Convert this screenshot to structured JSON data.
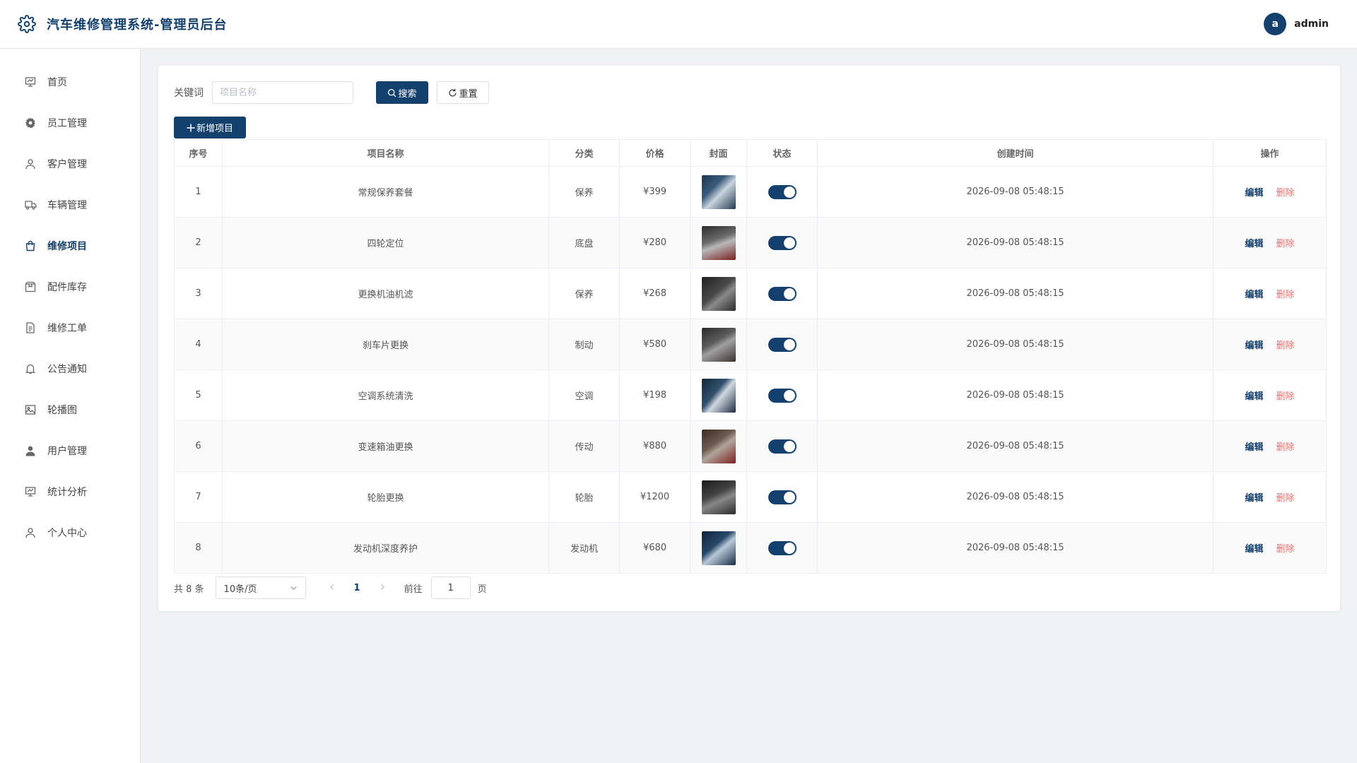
{
  "app": {
    "title": "汽车维修管理系统-管理员后台"
  },
  "user": {
    "avatar_letter": "a",
    "name": "admin"
  },
  "colors": {
    "primary": "#14406e",
    "danger": "#f56c6c",
    "background": "#f0f2f5"
  },
  "sidebar": {
    "items": [
      {
        "label": "首页",
        "icon": "dashboard-icon",
        "active": false
      },
      {
        "label": "员工管理",
        "icon": "gear-icon",
        "active": false
      },
      {
        "label": "客户管理",
        "icon": "user-icon",
        "active": false
      },
      {
        "label": "车辆管理",
        "icon": "truck-icon",
        "active": false
      },
      {
        "label": "维修项目",
        "icon": "bag-icon",
        "active": true
      },
      {
        "label": "配件库存",
        "icon": "box-icon",
        "active": false
      },
      {
        "label": "维修工单",
        "icon": "document-icon",
        "active": false
      },
      {
        "label": "公告通知",
        "icon": "bell-icon",
        "active": false
      },
      {
        "label": "轮播图",
        "icon": "picture-icon",
        "active": false
      },
      {
        "label": "用户管理",
        "icon": "user-filled-icon",
        "active": false
      },
      {
        "label": "统计分析",
        "icon": "chart-icon",
        "active": false
      },
      {
        "label": "个人中心",
        "icon": "user-icon",
        "active": false
      }
    ]
  },
  "search": {
    "label": "关键词",
    "placeholder": "项目名称",
    "value": "",
    "search_button": "搜索",
    "reset_button": "重置",
    "add_button": "新增项目"
  },
  "table": {
    "columns": [
      "序号",
      "项目名称",
      "分类",
      "价格",
      "封面",
      "状态",
      "创建时间",
      "操作"
    ],
    "edit_label": "编辑",
    "delete_label": "删除",
    "rows": [
      {
        "index": "1",
        "name": "常规保养套餐",
        "category": "保养",
        "price": "¥399",
        "status_on": true,
        "created": "2026-09-08 05:48:15"
      },
      {
        "index": "2",
        "name": "四轮定位",
        "category": "底盘",
        "price": "¥280",
        "status_on": true,
        "created": "2026-09-08 05:48:15"
      },
      {
        "index": "3",
        "name": "更换机油机滤",
        "category": "保养",
        "price": "¥268",
        "status_on": true,
        "created": "2026-09-08 05:48:15"
      },
      {
        "index": "4",
        "name": "刹车片更换",
        "category": "制动",
        "price": "¥580",
        "status_on": true,
        "created": "2026-09-08 05:48:15"
      },
      {
        "index": "5",
        "name": "空调系统清洗",
        "category": "空调",
        "price": "¥198",
        "status_on": true,
        "created": "2026-09-08 05:48:15"
      },
      {
        "index": "6",
        "name": "变速箱油更换",
        "category": "传动",
        "price": "¥880",
        "status_on": true,
        "created": "2026-09-08 05:48:15"
      },
      {
        "index": "7",
        "name": "轮胎更换",
        "category": "轮胎",
        "price": "¥1200",
        "status_on": true,
        "created": "2026-09-08 05:48:15"
      },
      {
        "index": "8",
        "name": "发动机深度养护",
        "category": "发动机",
        "price": "¥680",
        "status_on": true,
        "created": "2026-09-08 05:48:15"
      }
    ]
  },
  "pagination": {
    "total_text": "共 8 条",
    "page_size": "10条/页",
    "current_page": "1",
    "goto_label": "前往",
    "goto_value": "1",
    "goto_suffix": "页"
  }
}
